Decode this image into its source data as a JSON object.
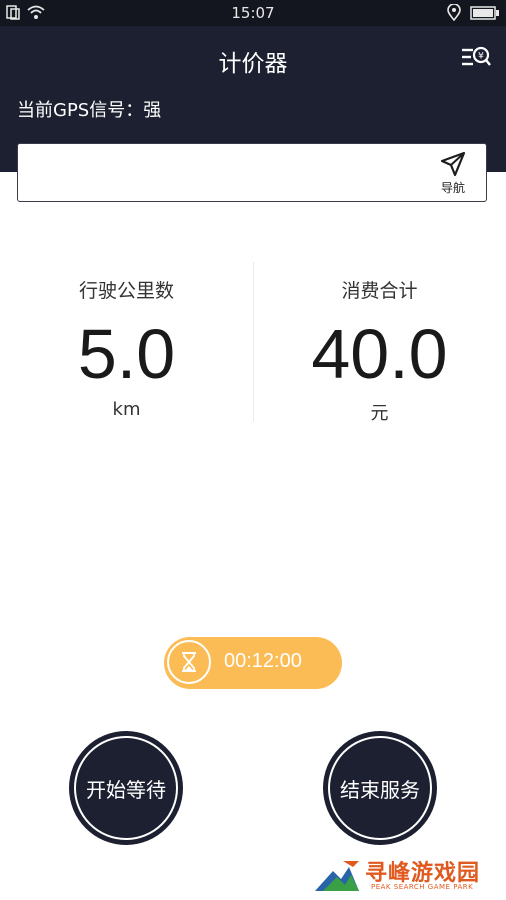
{
  "status_bar": {
    "time": "15:07"
  },
  "header": {
    "title": "计价器",
    "gps_label": "当前GPS信号：强"
  },
  "search": {
    "value": "",
    "placeholder": "",
    "nav_label": "导航"
  },
  "stats": {
    "distance": {
      "label": "行驶公里数",
      "value": "5.0",
      "unit": "km"
    },
    "cost": {
      "label": "消费合计",
      "value": "40.0",
      "unit": "元"
    }
  },
  "timer": {
    "value": "00:12:00"
  },
  "actions": {
    "start_wait": "开始等待",
    "end_service": "结束服务"
  },
  "watermark": {
    "title": "寻峰游戏园",
    "subtitle": "PEAK SEARCH GAME PARK"
  },
  "colors": {
    "header_bg": "#1d2030",
    "timer_bg": "#fcbc55"
  }
}
